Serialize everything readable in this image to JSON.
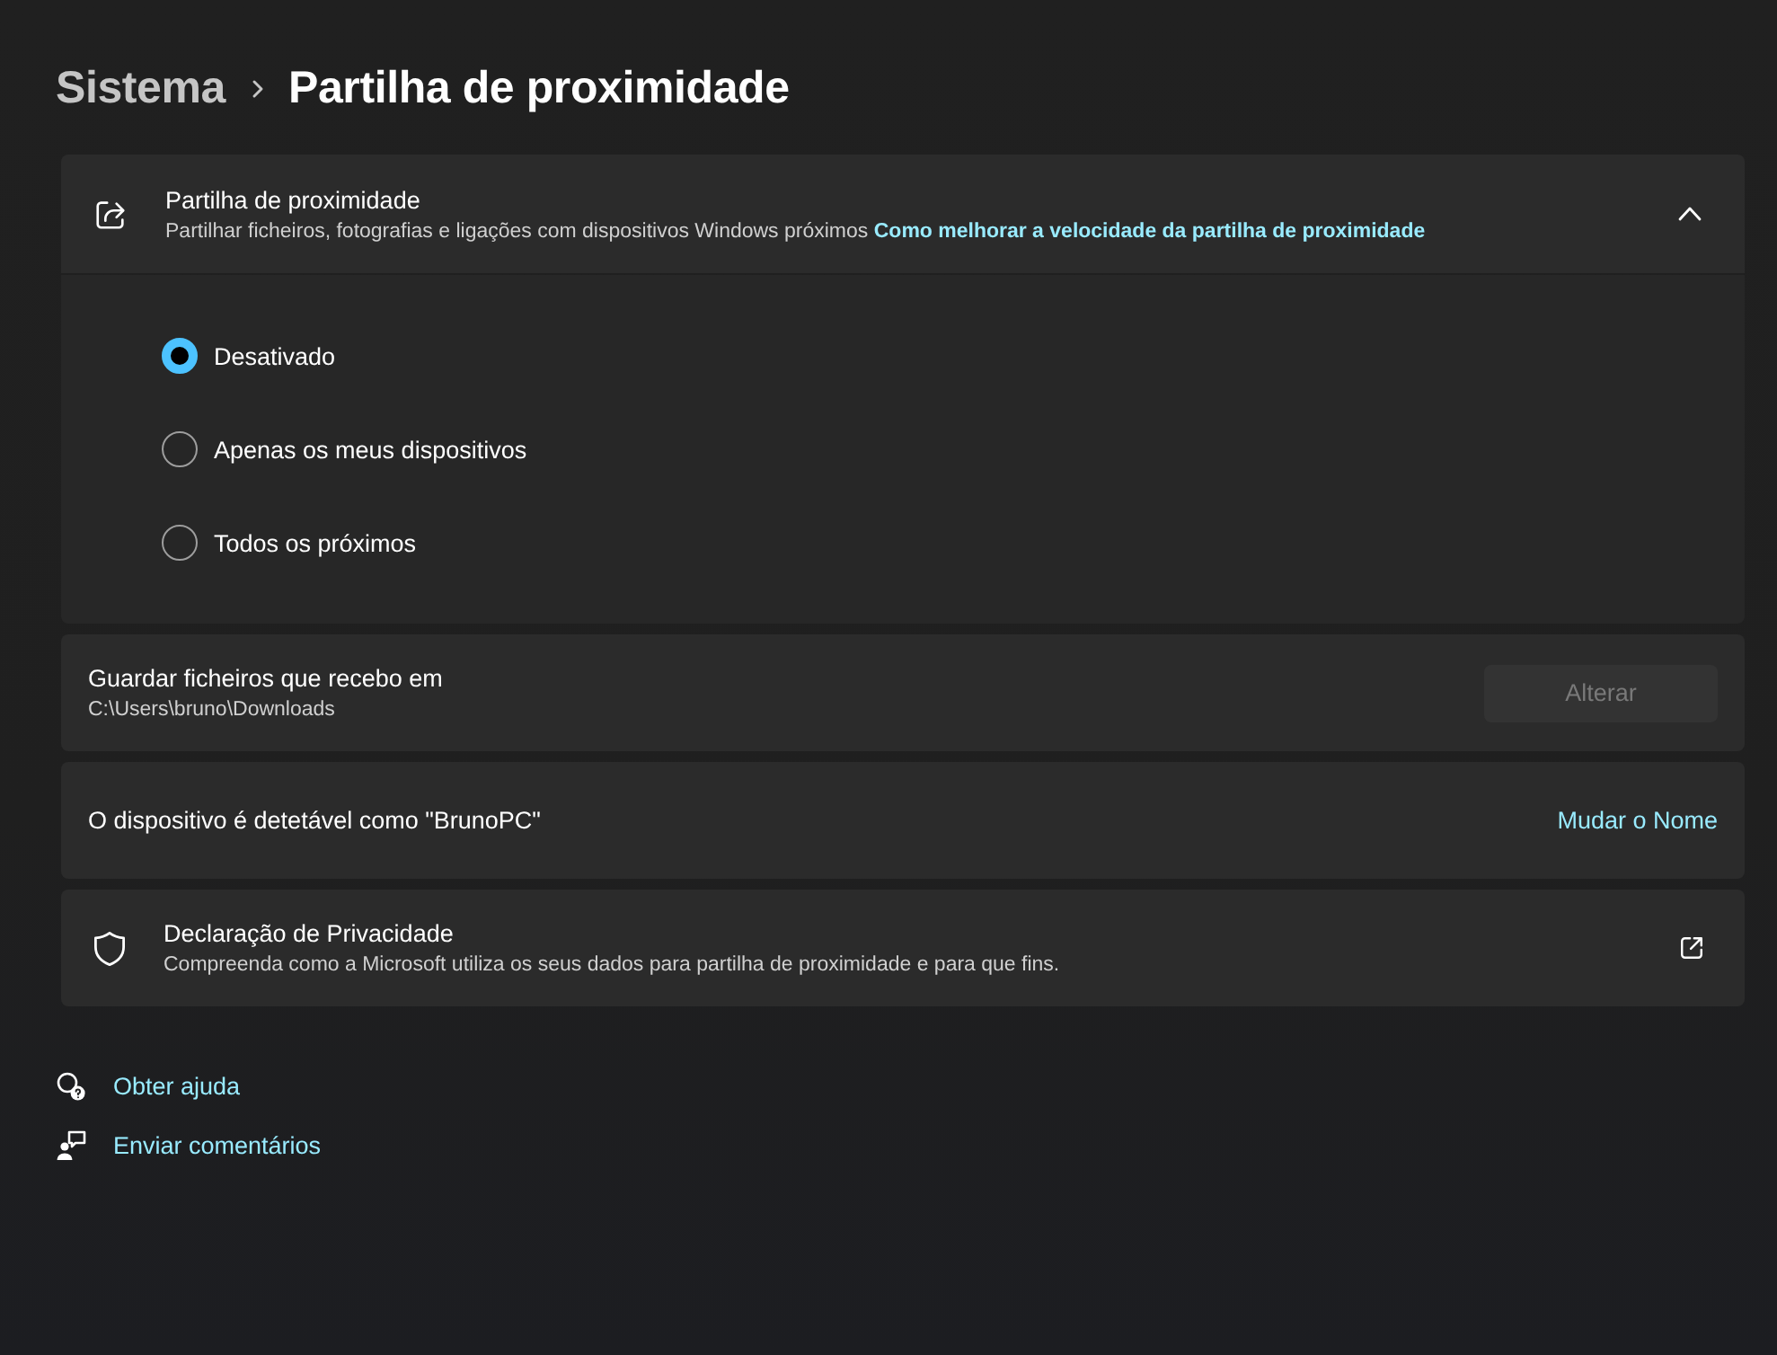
{
  "breadcrumb": {
    "parent": "Sistema",
    "current": "Partilha de proximidade"
  },
  "expander": {
    "title": "Partilha de proximidade",
    "description": "Partilhar ficheiros, fotografias e ligações com dispositivos Windows próximos",
    "link": "Como melhorar a velocidade da partilha de proximidade",
    "expanded": true,
    "options": [
      {
        "label": "Desativado",
        "selected": true
      },
      {
        "label": "Apenas os meus dispositivos",
        "selected": false
      },
      {
        "label": "Todos os próximos",
        "selected": false
      }
    ]
  },
  "settings": [
    {
      "kind": "folder",
      "title": "Guardar ficheiros que recebo em",
      "path": "C:\\Users\\bruno\\Downloads",
      "button": {
        "label": "Alterar",
        "disabled": true
      }
    },
    {
      "kind": "rename",
      "title": "O dispositivo é detetável como \"BrunoPC\"",
      "link": "Mudar o Nome"
    },
    {
      "kind": "external",
      "title": "Declaração de Privacidade",
      "description": "Compreenda como a Microsoft utiliza os seus dados para partilha de proximidade e para que fins."
    }
  ],
  "help_links": [
    {
      "kind": "help",
      "label": "Obter ajuda"
    },
    {
      "kind": "feedback",
      "label": "Enviar comentários"
    }
  ]
}
